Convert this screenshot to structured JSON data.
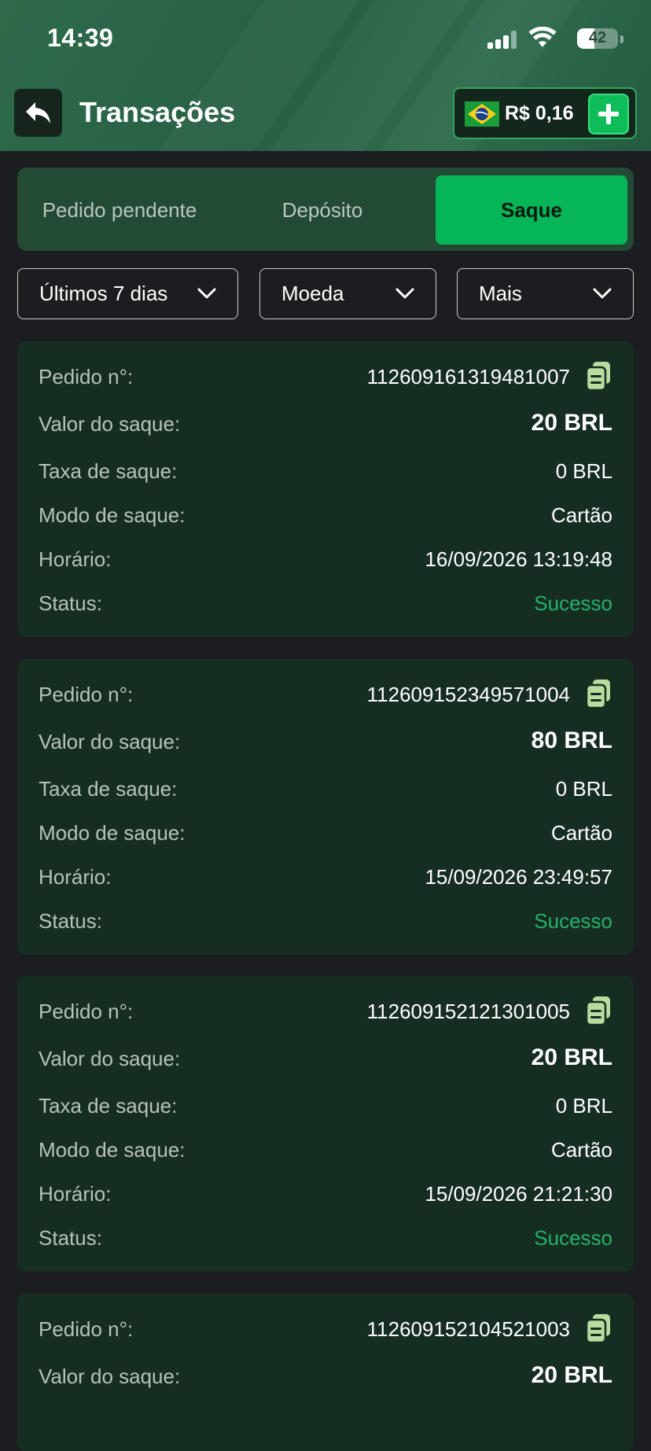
{
  "status_bar": {
    "time": "14:39",
    "battery": "42",
    "battery_level": 0.42
  },
  "header": {
    "title": "Transações",
    "balance": "R$ 0,16"
  },
  "tabs": [
    {
      "label": "Pedido pendente",
      "active": false
    },
    {
      "label": "Depósito",
      "active": false
    },
    {
      "label": "Saque",
      "active": true
    }
  ],
  "filters": [
    {
      "label": "Últimos 7 dias"
    },
    {
      "label": "Moeda"
    },
    {
      "label": "Mais"
    }
  ],
  "labels": {
    "order": "Pedido n°:",
    "amount": "Valor do saque:",
    "fee": "Taxa de saque:",
    "mode": "Modo de saque:",
    "time": "Horário:",
    "status": "Status:"
  },
  "transactions": [
    {
      "order": "112609161319481007",
      "amount": "20 BRL",
      "fee": "0 BRL",
      "mode": "Cartão",
      "time": "16/09/2026 13:19:48",
      "status": "Sucesso"
    },
    {
      "order": "112609152349571004",
      "amount": "80 BRL",
      "fee": "0 BRL",
      "mode": "Cartão",
      "time": "15/09/2026 23:49:57",
      "status": "Sucesso"
    },
    {
      "order": "112609152121301005",
      "amount": "20 BRL",
      "fee": "0 BRL",
      "mode": "Cartão",
      "time": "15/09/2026 21:21:30",
      "status": "Sucesso"
    },
    {
      "order": "112609152104521003",
      "amount": "20 BRL"
    }
  ],
  "colors": {
    "accent": "#07b559",
    "success": "#24b16a",
    "card": "#162e22",
    "background": "#1b1d20"
  },
  "icons": [
    "back-arrow-icon",
    "brazil-flag-icon",
    "plus-icon",
    "chevron-down-icon",
    "copy-icon",
    "signal-icon",
    "wifi-icon",
    "battery-icon"
  ]
}
